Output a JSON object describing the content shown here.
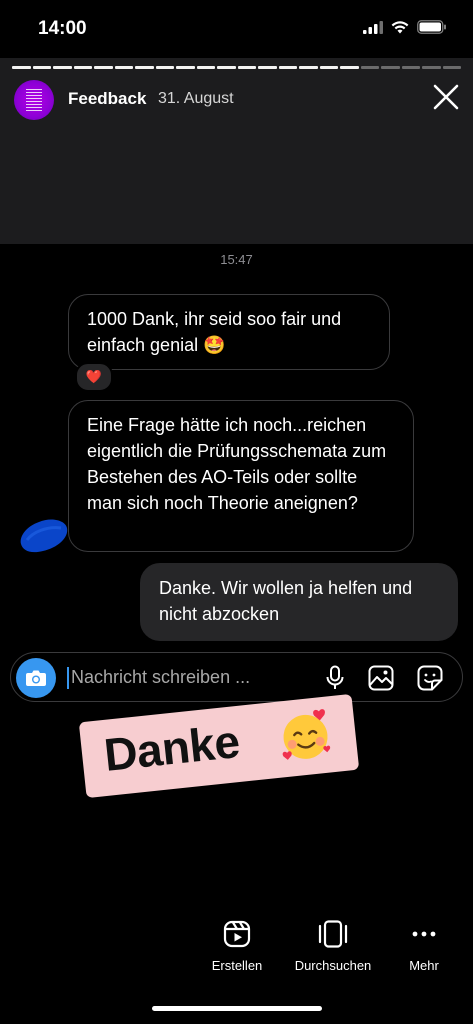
{
  "status_bar": {
    "time": "14:00"
  },
  "story": {
    "name": "Feedback",
    "date": "31. August",
    "progress": {
      "segments": 22,
      "viewed": 17
    }
  },
  "chat": {
    "timestamp": "15:47",
    "messages": [
      {
        "direction": "incoming",
        "text": "1000 Dank, ihr seid soo fair und einfach genial 🤩",
        "reaction": "❤️"
      },
      {
        "direction": "incoming",
        "text": "Eine Frage hätte ich noch...reichen eigentlich die Prüfungsschemata zum Bestehen des AO-Teils oder sollte man sich noch Theorie aneignen?"
      },
      {
        "direction": "outgoing",
        "text": "Danke. Wir wollen ja helfen und nicht abzocken"
      }
    ]
  },
  "composer": {
    "placeholder": "Nachricht schreiben ..."
  },
  "sticker": {
    "text": "Danke",
    "emoji": "smiling-face-with-hearts"
  },
  "bottom_nav": {
    "create": "Erstellen",
    "browse": "Durchsuchen",
    "more": "Mehr"
  },
  "colors": {
    "accent": "#3797f0",
    "sticker_bg": "#f7cdd0",
    "avatar": "#a000e0"
  }
}
